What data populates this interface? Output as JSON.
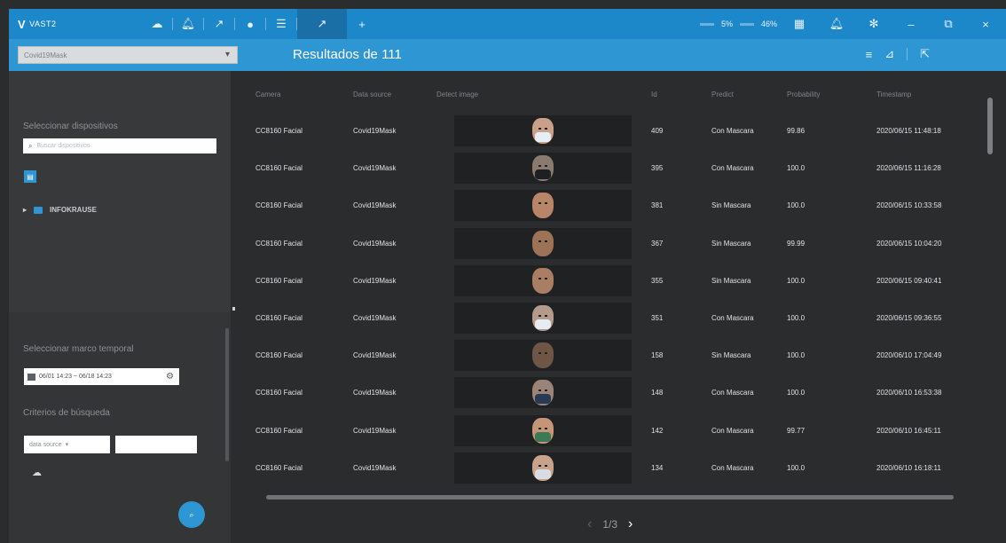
{
  "topbar": {
    "logo_mark": "V",
    "logo_text": "VAST2",
    "icons": [
      "cloud-icon",
      "bell-icon",
      "analytics-icon",
      "pin-icon",
      "list-icon",
      "analytics-active-icon",
      "add-icon"
    ],
    "stats": [
      {
        "label": "5%"
      },
      {
        "label": "46%"
      }
    ],
    "right_icons": [
      "grid-icon",
      "bell-icon",
      "settings-icon",
      "minimize-icon",
      "restore-icon",
      "close-icon"
    ]
  },
  "subbar": {
    "device_select_value": "Covid19Mask",
    "results_title": "Resultados de 111"
  },
  "left": {
    "devices_title": "Seleccionar dispositivos",
    "search_placeholder": "Buscar dispositivos",
    "tree_root": "INFOKRAUSE",
    "time_title": "Seleccionar marco temporal",
    "date_range": "06/01 14:23 ~ 06/18 14:23",
    "criteria_title": "Criterios de búsqueda",
    "criteria_select": "data source"
  },
  "table": {
    "headers": [
      "Camera",
      "Data source",
      "Detect image",
      "Id",
      "Predict",
      "Probability",
      "Timestamp"
    ],
    "rows": [
      {
        "camera": "CC8160 Facial",
        "source": "Covid19Mask",
        "id": "409",
        "predict": "Con Mascara",
        "probability": "99.86",
        "timestamp": "2020/06/15 11:48:18",
        "mask": true,
        "skin": "#c9a08a",
        "mask_color": "#e8eef5"
      },
      {
        "camera": "CC8160 Facial",
        "source": "Covid19Mask",
        "id": "395",
        "predict": "Con Mascara",
        "probability": "100.0",
        "timestamp": "2020/06/15 11:16:28",
        "mask": true,
        "skin": "#8a7a70",
        "mask_color": "#1d1f22"
      },
      {
        "camera": "CC8160 Facial",
        "source": "Covid19Mask",
        "id": "381",
        "predict": "Sin Mascara",
        "probability": "100.0",
        "timestamp": "2020/06/15 10:33:58",
        "mask": false,
        "skin": "#b98568",
        "mask_color": ""
      },
      {
        "camera": "CC8160 Facial",
        "source": "Covid19Mask",
        "id": "367",
        "predict": "Sin Mascara",
        "probability": "99.99",
        "timestamp": "2020/06/15 10:04:20",
        "mask": false,
        "skin": "#9c7357",
        "mask_color": ""
      },
      {
        "camera": "CC8160 Facial",
        "source": "Covid19Mask",
        "id": "355",
        "predict": "Sin Mascara",
        "probability": "100.0",
        "timestamp": "2020/06/15 09:40:41",
        "mask": false,
        "skin": "#a97e62",
        "mask_color": ""
      },
      {
        "camera": "CC8160 Facial",
        "source": "Covid19Mask",
        "id": "351",
        "predict": "Con Mascara",
        "probability": "100.0",
        "timestamp": "2020/06/15 09:36:55",
        "mask": true,
        "skin": "#b49a8a",
        "mask_color": "#e6ecf2"
      },
      {
        "camera": "CC8160 Facial",
        "source": "Covid19Mask",
        "id": "158",
        "predict": "Sin Mascara",
        "probability": "100.0",
        "timestamp": "2020/06/10 17:04:49",
        "mask": false,
        "skin": "#6e5546",
        "mask_color": ""
      },
      {
        "camera": "CC8160 Facial",
        "source": "Covid19Mask",
        "id": "148",
        "predict": "Con Mascara",
        "probability": "100.0",
        "timestamp": "2020/06/10 16:53:38",
        "mask": true,
        "skin": "#9a8478",
        "mask_color": "#2a3a55"
      },
      {
        "camera": "CC8160 Facial",
        "source": "Covid19Mask",
        "id": "142",
        "predict": "Con Mascara",
        "probability": "99.77",
        "timestamp": "2020/06/10 16:45:11",
        "mask": true,
        "skin": "#c49577",
        "mask_color": "#3a7a55"
      },
      {
        "camera": "CC8160 Facial",
        "source": "Covid19Mask",
        "id": "134",
        "predict": "Con Mascara",
        "probability": "100.0",
        "timestamp": "2020/06/10 16:18:11",
        "mask": true,
        "skin": "#c8a38c",
        "mask_color": "#d8dde3"
      }
    ]
  },
  "pager": {
    "label": "1/3"
  },
  "colors": {
    "topbar": "#1c87c9",
    "subbar": "#2f96d4",
    "background": "#2b2c2e",
    "panel": "#353739"
  }
}
